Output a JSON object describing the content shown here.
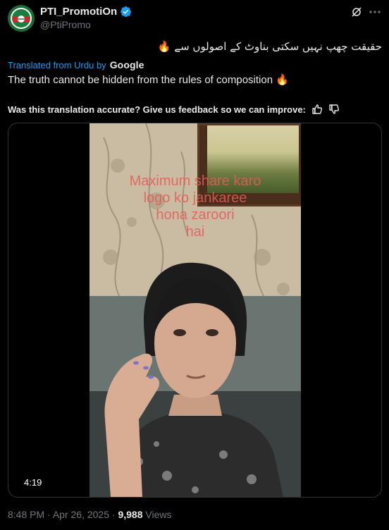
{
  "tweet": {
    "display_name": "PTI_PromotiOn",
    "handle": "@PtiPromo",
    "original_text": "حقیقت چھپ نہیں سکتی بناوٹ کے اصولوں سے",
    "original_emoji": "🔥",
    "translated_label": "Translated from Urdu by",
    "translator_brand": "Google",
    "translation_text": "The truth cannot be hidden from the rules of composition",
    "translation_emoji": "🔥",
    "feedback_text": "Was this translation accurate? Give us feedback so we can improve:",
    "video": {
      "overlay_text": "Maximum share karo\nlogo ko jankaree\nhona zaroori\nhai",
      "duration": "4:19"
    },
    "time": "8:48 PM",
    "separator": "·",
    "date": "Apr 26, 2025",
    "views_count": "9,988",
    "views_label": "Views"
  },
  "colors": {
    "background": "#000000",
    "text": "#e7e9ea",
    "muted": "#71767b",
    "accent": "#1d9bf0",
    "border": "#2f3336"
  },
  "icons": {
    "verified": "verified-badge-icon",
    "grok": "grok-icon",
    "more": "more-icon",
    "thumbs_up": "thumbs-up-icon",
    "thumbs_down": "thumbs-down-icon"
  }
}
